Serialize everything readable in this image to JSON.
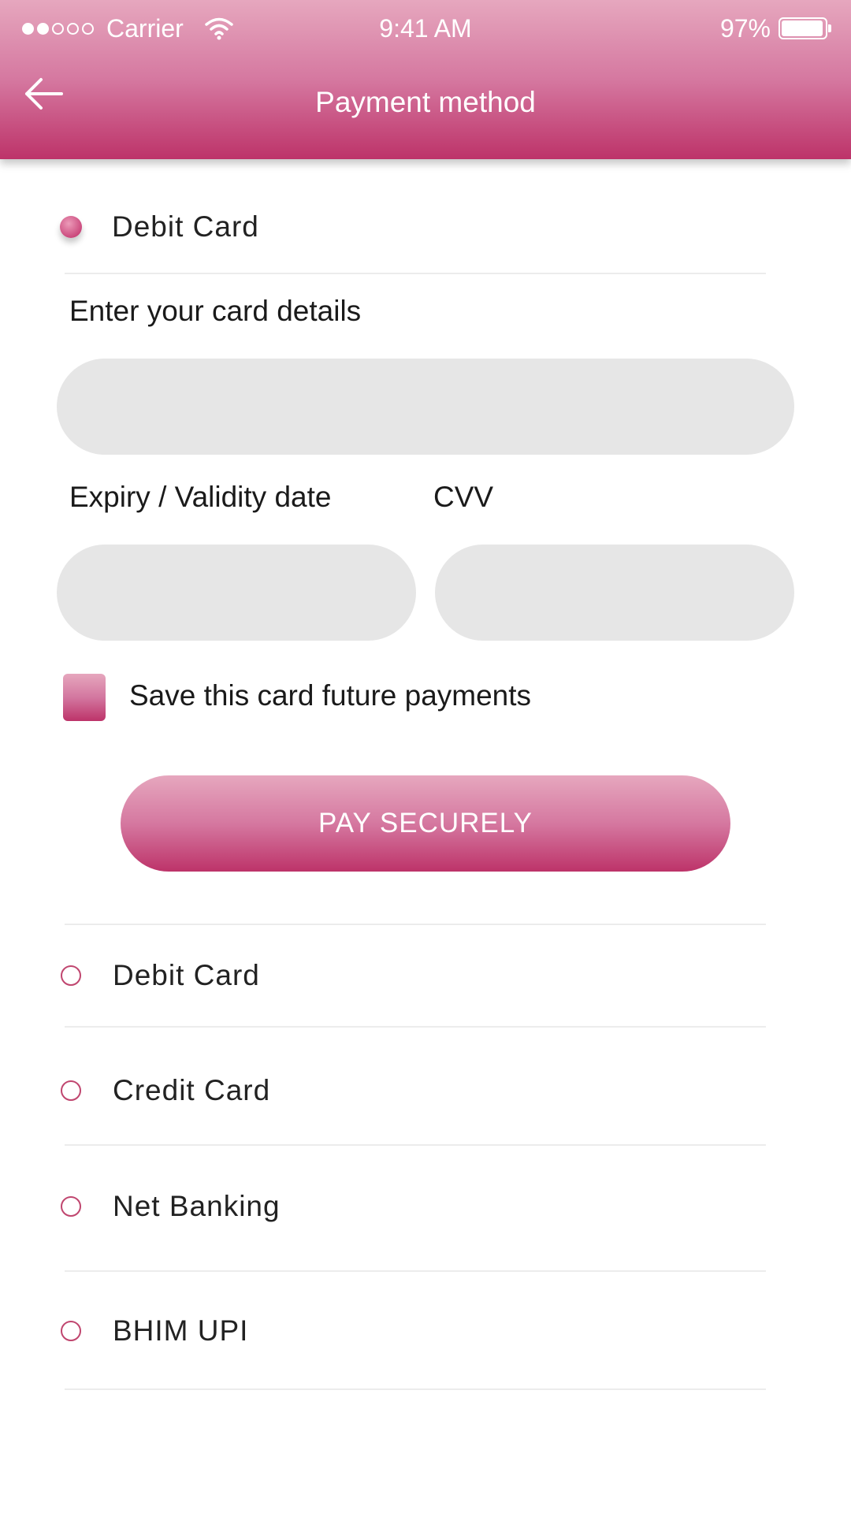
{
  "status_bar": {
    "carrier": "Carrier",
    "time": "9:41 AM",
    "battery": "97%",
    "battery_level": 0.97,
    "signal_bars_filled": 2,
    "signal_bars_total": 5
  },
  "header": {
    "title": "Payment method",
    "back_icon": "arrow-left-icon"
  },
  "selected_method": {
    "label": "Debit Card"
  },
  "card_form": {
    "card_details_label": "Enter your card details",
    "card_number_value": "",
    "expiry_label": "Expiry / Validity date",
    "expiry_value": "",
    "cvv_label": "CVV",
    "cvv_value": "",
    "save_card_label": "Save this card future payments",
    "pay_button": "PAY SECURELY"
  },
  "options": [
    {
      "label": "Debit Card"
    },
    {
      "label": "Credit Card"
    },
    {
      "label": "Net Banking"
    },
    {
      "label": "BHIM UPI"
    }
  ],
  "colors": {
    "accent_light": "#e6a7be",
    "accent_dark": "#bd3369",
    "field_bg": "#e6e6e6"
  }
}
